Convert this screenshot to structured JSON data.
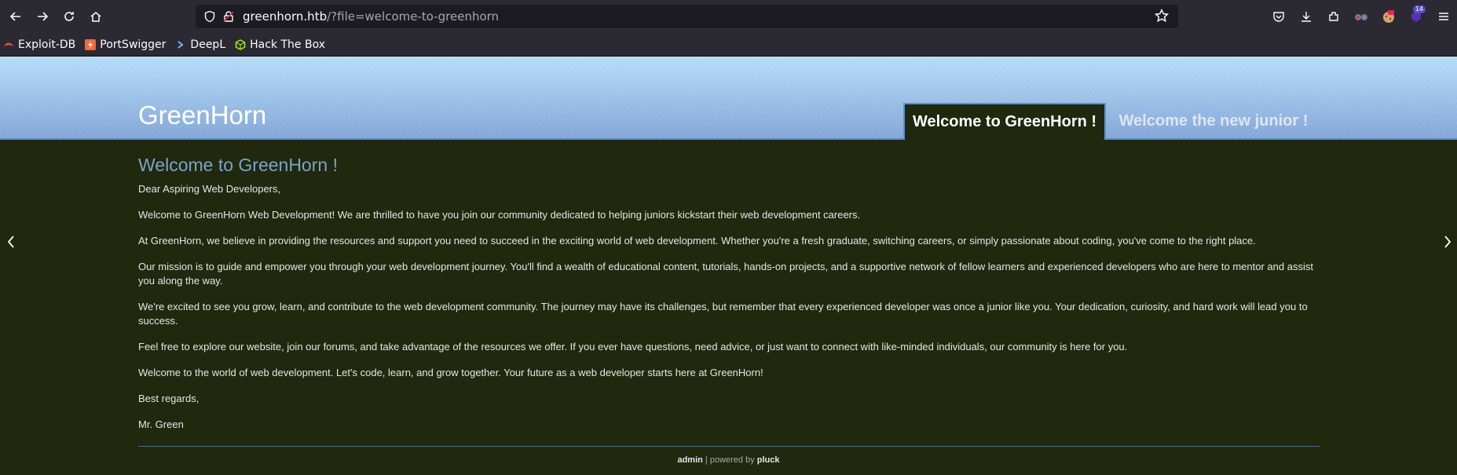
{
  "browser": {
    "url_host": "greenhorn.htb",
    "url_path": "/?file=welcome-to-greenhorn",
    "bookmarks": [
      "Exploit-DB",
      "PortSwigger",
      "DeepL",
      "Hack The Box"
    ],
    "extension_badge": "14"
  },
  "site": {
    "title": "GreenHorn",
    "tabs": [
      "Welcome to GreenHorn !",
      "Welcome the new junior !"
    ]
  },
  "article": {
    "heading": "Welcome to GreenHorn !",
    "paragraphs": [
      "Dear Aspiring Web Developers,",
      "Welcome to GreenHorn Web Development! We are thrilled to have you join our community dedicated to helping juniors kickstart their web development careers.",
      "At GreenHorn, we believe in providing the resources and support you need to succeed in the exciting world of web development. Whether you're a fresh graduate, switching careers, or simply passionate about coding, you've come to the right place.",
      "Our mission is to guide and empower you through your web development journey. You'll find a wealth of educational content, tutorials, hands-on projects, and a supportive network of fellow learners and experienced developers who are here to mentor and assist you along the way.",
      "We're excited to see you grow, learn, and contribute to the web development community. The journey may have its challenges, but remember that every experienced developer was once a junior like you. Your dedication, curiosity, and hard work will lead you to success.",
      "Feel free to explore our website, join our forums, and take advantage of the resources we offer. If you ever have questions, need advice, or just want to connect with like-minded individuals, our community is here for you.",
      "Welcome to the world of web development. Let's code, learn, and grow together. Your future as a web developer starts here at GreenHorn!",
      "Best regards,",
      "Mr. Green"
    ]
  },
  "footer": {
    "admin": "admin",
    "separator": " | powered by ",
    "pluck": "pluck"
  }
}
